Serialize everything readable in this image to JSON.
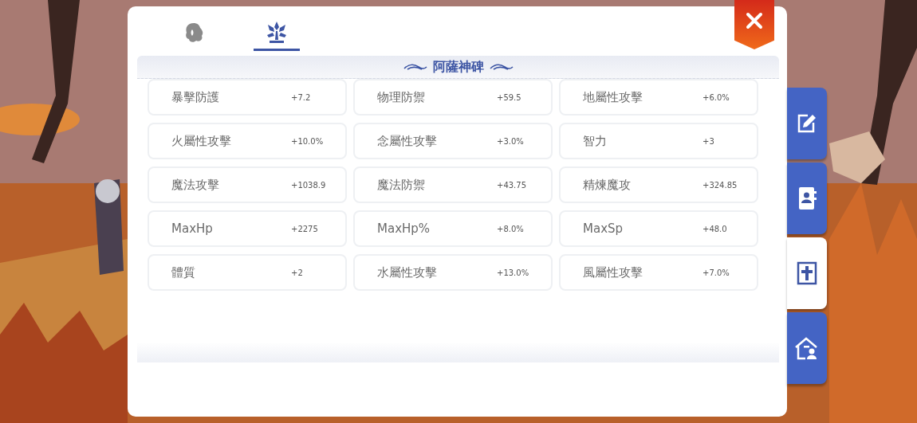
{
  "top_tabs": [
    {
      "selected": false
    },
    {
      "selected": true
    }
  ],
  "section_title": "阿薩神碑",
  "stats": [
    {
      "label": "暴擊防護",
      "value": "+7.2"
    },
    {
      "label": "物理防禦",
      "value": "+59.5"
    },
    {
      "label": "地屬性攻擊",
      "value": "+6.0%"
    },
    {
      "label": "火屬性攻擊",
      "value": "+10.0%"
    },
    {
      "label": "念屬性攻擊",
      "value": "+3.0%"
    },
    {
      "label": "智力",
      "value": "+3"
    },
    {
      "label": "魔法攻擊",
      "value": "+1038.9"
    },
    {
      "label": "魔法防禦",
      "value": "+43.75"
    },
    {
      "label": "精煉魔攻",
      "value": "+324.85"
    },
    {
      "label": "MaxHp",
      "value": "+2275"
    },
    {
      "label": "MaxHp%",
      "value": "+8.0%"
    },
    {
      "label": "MaxSp",
      "value": "+48.0"
    },
    {
      "label": "體質",
      "value": "+2"
    },
    {
      "label": "水屬性攻擊",
      "value": "+13.0%"
    },
    {
      "label": "風屬性攻擊",
      "value": "+7.0%"
    }
  ],
  "side_tabs": [
    {
      "selected": false
    },
    {
      "selected": false
    },
    {
      "selected": true
    },
    {
      "selected": false
    }
  ]
}
